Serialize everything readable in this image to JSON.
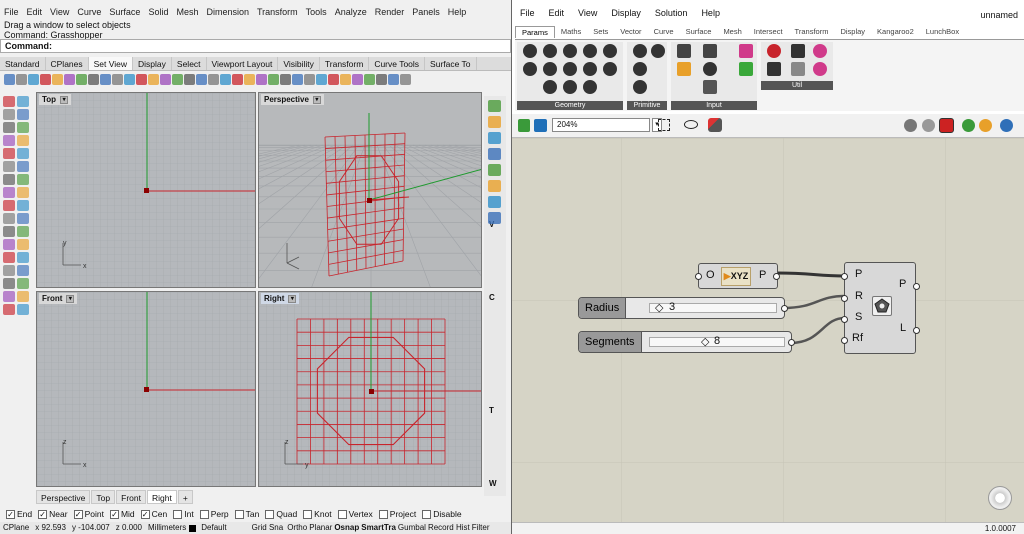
{
  "rhino": {
    "menu": [
      "File",
      "Edit",
      "View",
      "Curve",
      "Surface",
      "Solid",
      "Mesh",
      "Dimension",
      "Transform",
      "Tools",
      "Analyze",
      "Render",
      "Panels",
      "Help"
    ],
    "cmd_history": [
      "Drag a window to select objects",
      "Command: Grasshopper"
    ],
    "cmd_prompt": "Command:",
    "toolbar_tabs": [
      "Standard",
      "CPlanes",
      "Set View",
      "Display",
      "Select",
      "Viewport Layout",
      "Visibility",
      "Transform",
      "Curve Tools",
      "Surface To"
    ],
    "active_toolbar_tab": "Set View",
    "viewports": {
      "top": "Top",
      "perspective": "Perspective",
      "front": "Front",
      "right": "Right"
    },
    "axis_labels": {
      "x": "x",
      "y": "y",
      "z": "z"
    },
    "viewport_tabs": [
      "Perspective",
      "Top",
      "Front",
      "Right"
    ],
    "active_viewport_tab": "Right",
    "osnaps": [
      {
        "label": "End",
        "checked": true
      },
      {
        "label": "Near",
        "checked": true
      },
      {
        "label": "Point",
        "checked": true
      },
      {
        "label": "Mid",
        "checked": true
      },
      {
        "label": "Cen",
        "checked": true
      },
      {
        "label": "Int",
        "checked": false
      },
      {
        "label": "Perp",
        "checked": false
      },
      {
        "label": "Tan",
        "checked": false
      },
      {
        "label": "Quad",
        "checked": false
      },
      {
        "label": "Knot",
        "checked": false
      },
      {
        "label": "Vertex",
        "checked": false
      },
      {
        "label": "Project",
        "checked": false
      },
      {
        "label": "Disable",
        "checked": false
      }
    ],
    "status": {
      "cplane": "CPlane",
      "x": "x 92.593",
      "y": "y -104.007",
      "z": "z 0.000",
      "units": "Millimeters",
      "layer": "Default",
      "toggles": [
        "Grid Sna",
        "Ortho",
        "Planar",
        "Osnap",
        "SmartTra",
        "Gumbal",
        "Record Hist",
        "Filter"
      ]
    },
    "side_letters": [
      "V",
      "C",
      "T",
      "W"
    ]
  },
  "grasshopper": {
    "menu": [
      "File",
      "Edit",
      "View",
      "Display",
      "Solution",
      "Help"
    ],
    "doc_name": "unnamed",
    "component_tabs": [
      "Params",
      "Maths",
      "Sets",
      "Vector",
      "Curve",
      "Surface",
      "Mesh",
      "Intersect",
      "Transform",
      "Display",
      "Kangaroo2",
      "LunchBox"
    ],
    "active_tab": "Params",
    "panels": [
      "Geometry",
      "Primitive",
      "Input",
      "Util"
    ],
    "zoom": "204%",
    "version": "1.0.0007",
    "canvas": {
      "xyz_component": {
        "input": "O",
        "label": "XYZ",
        "output": "P"
      },
      "radius_slider": {
        "name": "Radius",
        "value": "3"
      },
      "segments_slider": {
        "name": "Segments",
        "value": "8"
      },
      "polygon": {
        "inputs": [
          "P",
          "R",
          "S",
          "Rf"
        ],
        "outputs": [
          "P",
          "L"
        ]
      }
    }
  },
  "colors": {
    "accent": "#c8242c",
    "axis_green": "#1d9a2d",
    "gh_canvas": "#d6d4c6",
    "viewport_bg": "#b5b8bc"
  }
}
